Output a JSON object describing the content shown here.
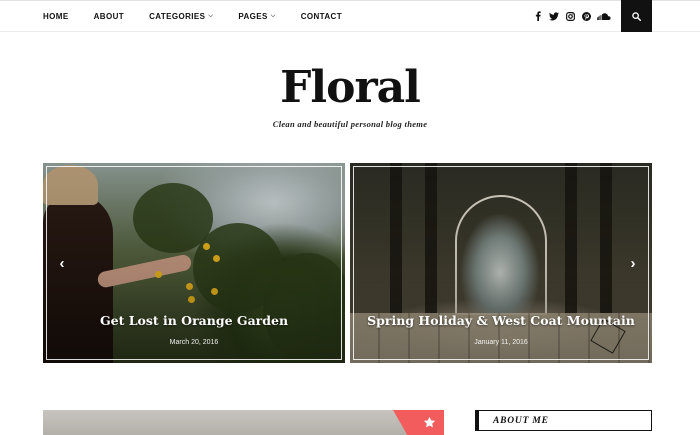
{
  "nav": {
    "items": [
      {
        "label": "HOME",
        "has_caret": false
      },
      {
        "label": "ABOUT",
        "has_caret": false
      },
      {
        "label": "CATEGORIES",
        "has_caret": true
      },
      {
        "label": "PAGES",
        "has_caret": true
      },
      {
        "label": "CONTACT",
        "has_caret": false
      }
    ],
    "caret_glyph": "⌵"
  },
  "social": {
    "icons": [
      "facebook-icon",
      "twitter-icon",
      "instagram-icon",
      "pinterest-icon",
      "soundcloud-icon"
    ]
  },
  "search": {
    "icon": "search-icon"
  },
  "header": {
    "title": "Floral",
    "tagline": "Clean and beautiful personal blog theme"
  },
  "slider": {
    "slides": [
      {
        "title": "Get Lost in Orange Garden",
        "date": "March 20, 2016"
      },
      {
        "title": "Spring Holiday & West Coat Mountain",
        "date": "January 11, 2016"
      }
    ],
    "prev_arrow": "‹",
    "next_arrow": "›"
  },
  "sidebar": {
    "widget_title": "ABOUT ME"
  },
  "featured": {
    "badge_icon": "star-icon"
  },
  "colors": {
    "accent": "#f25c5c",
    "dark": "#111111"
  }
}
